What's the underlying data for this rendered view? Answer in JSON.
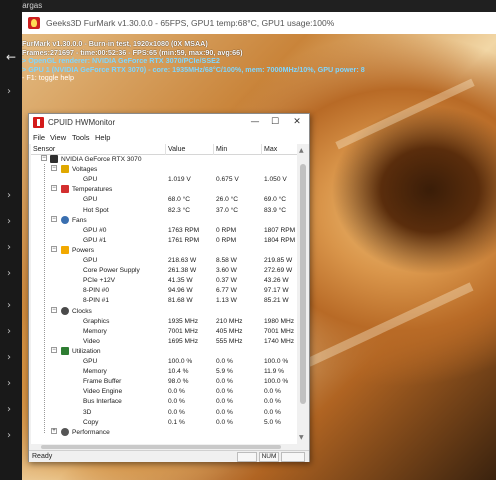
{
  "taskbar_strip": {
    "title": "Descargas"
  },
  "furmark": {
    "window_title": "Geeks3D FurMark v1.30.0.0 - 65FPS, GPU1 temp:68°C, GPU1 usage:100%",
    "osd": [
      "FurMark v1.30.0.0 - Burn-in test, 1920x1080 (0X MSAA)",
      "Frames:271697 - time:00:52:36 - FPS:65 (min:59, max:90, avg:66)",
      "> OpenGL renderer: NVIDIA GeForce RTX 3070/PCIe/SSE2",
      "> GPU 1 (NVIDIA GeForce RTX 3070) - core: 1935MHz/68°C/100%, mem: 7000MHz/10%, GPU power: 8",
      "- F1: toggle help"
    ]
  },
  "hwmonitor": {
    "title": "CPUID HWMonitor",
    "menu": [
      "File",
      "View",
      "Tools",
      "Help"
    ],
    "columns": [
      "Sensor",
      "Value",
      "Min",
      "Max"
    ],
    "device": "NVIDIA GeForce RTX 3070",
    "groups": [
      {
        "name": "Voltages",
        "icon": "voltage-icon",
        "color": "#e0a800",
        "rows": [
          {
            "sensor": "GPU",
            "value": "1.019 V",
            "min": "0.675 V",
            "max": "1.050 V"
          }
        ]
      },
      {
        "name": "Temperatures",
        "icon": "thermometer-icon",
        "color": "#d32f2f",
        "rows": [
          {
            "sensor": "GPU",
            "value": "68.0 °C",
            "min": "26.0 °C",
            "max": "69.0 °C"
          },
          {
            "sensor": "Hot Spot",
            "value": "82.3 °C",
            "min": "37.0 °C",
            "max": "83.9 °C"
          }
        ]
      },
      {
        "name": "Fans",
        "icon": "fan-icon",
        "color": "#3a6fb0",
        "rows": [
          {
            "sensor": "GPU #0",
            "value": "1763 RPM",
            "min": "0 RPM",
            "max": "1807 RPM"
          },
          {
            "sensor": "GPU #1",
            "value": "1761 RPM",
            "min": "0 RPM",
            "max": "1804 RPM"
          }
        ]
      },
      {
        "name": "Powers",
        "icon": "power-icon",
        "color": "#f2a900",
        "rows": [
          {
            "sensor": "GPU",
            "value": "218.63 W",
            "min": "8.58 W",
            "max": "219.85 W"
          },
          {
            "sensor": "Core Power Supply",
            "value": "261.38 W",
            "min": "3.60 W",
            "max": "272.69 W"
          },
          {
            "sensor": "PCIe +12V",
            "value": "41.35 W",
            "min": "0.37 W",
            "max": "43.26 W"
          },
          {
            "sensor": "8-PIN #0",
            "value": "94.96 W",
            "min": "6.77 W",
            "max": "97.17 W"
          },
          {
            "sensor": "8-PIN #1",
            "value": "81.68 W",
            "min": "1.13 W",
            "max": "85.21 W"
          }
        ]
      },
      {
        "name": "Clocks",
        "icon": "clock-icon",
        "color": "#4a4a4a",
        "rows": [
          {
            "sensor": "Graphics",
            "value": "1935 MHz",
            "min": "210 MHz",
            "max": "1980 MHz"
          },
          {
            "sensor": "Memory",
            "value": "7001 MHz",
            "min": "405 MHz",
            "max": "7001 MHz"
          },
          {
            "sensor": "Video",
            "value": "1695 MHz",
            "min": "555 MHz",
            "max": "1740 MHz"
          }
        ]
      },
      {
        "name": "Utilization",
        "icon": "utilization-icon",
        "color": "#2e7d32",
        "rows": [
          {
            "sensor": "GPU",
            "value": "100.0 %",
            "min": "0.0 %",
            "max": "100.0 %"
          },
          {
            "sensor": "Memory",
            "value": "10.4 %",
            "min": "5.9 %",
            "max": "11.9 %"
          },
          {
            "sensor": "Frame Buffer",
            "value": "98.0 %",
            "min": "0.0 %",
            "max": "100.0 %"
          },
          {
            "sensor": "Video Engine",
            "value": "0.0 %",
            "min": "0.0 %",
            "max": "0.0 %"
          },
          {
            "sensor": "Bus Interface",
            "value": "0.0 %",
            "min": "0.0 %",
            "max": "0.0 %"
          },
          {
            "sensor": "3D",
            "value": "0.0 %",
            "min": "0.0 %",
            "max": "0.0 %"
          },
          {
            "sensor": "Copy",
            "value": "0.1 %",
            "min": "0.0 %",
            "max": "5.0 %"
          }
        ]
      },
      {
        "name": "Performance",
        "icon": "performance-icon",
        "color": "#555555",
        "rows": []
      }
    ],
    "status": {
      "ready": "Ready",
      "num": "NUM"
    }
  }
}
